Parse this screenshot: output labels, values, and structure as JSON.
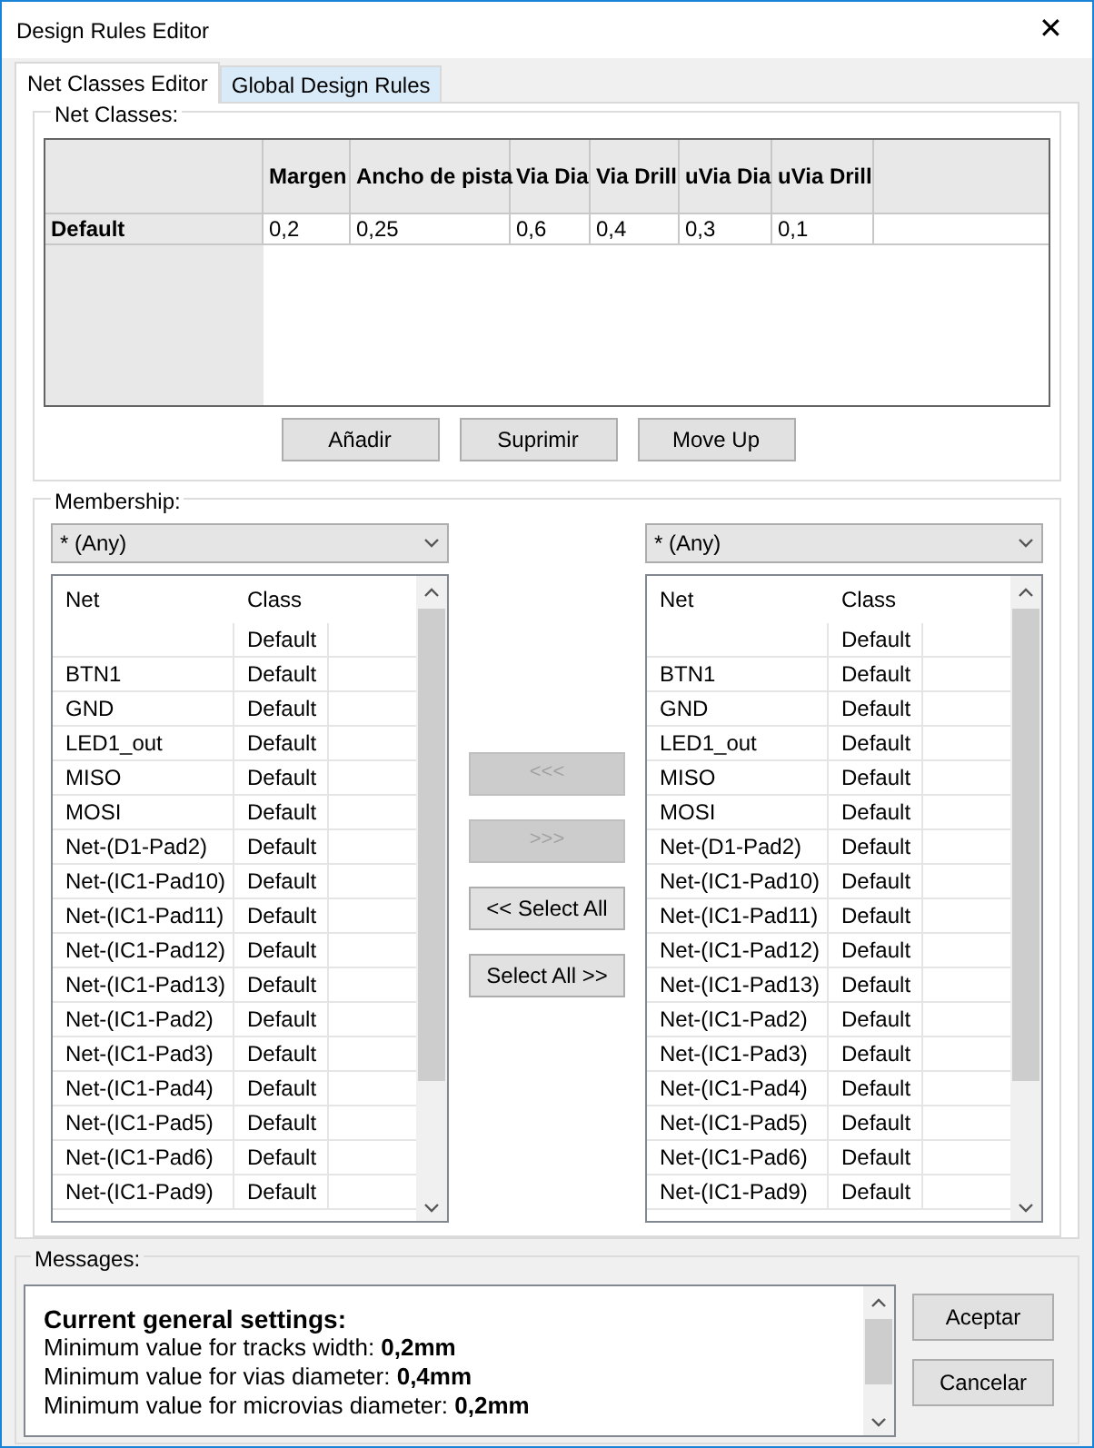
{
  "window": {
    "title": "Design Rules Editor",
    "close": "✕"
  },
  "tabs": [
    {
      "label": "Net Classes Editor",
      "selected": true
    },
    {
      "label": "Global Design Rules",
      "selected": false
    }
  ],
  "net_classes": {
    "label": "Net Classes:",
    "columns": [
      "Margen",
      "Ancho de pista",
      "Via Dia",
      "Via Drill",
      "uVia Dia",
      "uVia Drill"
    ],
    "rows": [
      {
        "name": "Default",
        "values": [
          "0,2",
          "0,25",
          "0,6",
          "0,4",
          "0,3",
          "0,1"
        ]
      }
    ],
    "buttons": [
      "Añadir",
      "Suprimir",
      "Move Up"
    ]
  },
  "membership": {
    "label": "Membership:",
    "left": {
      "filter": "* (Any)",
      "columns": [
        "Net",
        "Class"
      ],
      "rows": [
        {
          "class": "Default"
        },
        {
          "net": "BTN1",
          "class": "Default"
        },
        {
          "net": "GND",
          "class": "Default"
        },
        {
          "net": "LED1_out",
          "class": "Default"
        },
        {
          "net": "MISO",
          "class": "Default"
        },
        {
          "net": "MOSI",
          "class": "Default"
        },
        {
          "net": "Net-(D1-Pad2)",
          "class": "Default"
        },
        {
          "net": "Net-(IC1-Pad10)",
          "class": "Default"
        },
        {
          "net": "Net-(IC1-Pad11)",
          "class": "Default"
        },
        {
          "net": "Net-(IC1-Pad12)",
          "class": "Default"
        },
        {
          "net": "Net-(IC1-Pad13)",
          "class": "Default"
        },
        {
          "net": "Net-(IC1-Pad2)",
          "class": "Default"
        },
        {
          "net": "Net-(IC1-Pad3)",
          "class": "Default"
        },
        {
          "net": "Net-(IC1-Pad4)",
          "class": "Default"
        },
        {
          "net": "Net-(IC1-Pad5)",
          "class": "Default"
        },
        {
          "net": "Net-(IC1-Pad6)",
          "class": "Default"
        },
        {
          "net": "Net-(IC1-Pad9)",
          "class": "Default"
        }
      ]
    },
    "transfer_buttons": [
      {
        "label": "<<<",
        "disabled": true
      },
      {
        "label": ">>>",
        "disabled": true
      },
      {
        "label": "<< Select All",
        "disabled": false
      },
      {
        "label": "Select All >>",
        "disabled": false
      }
    ],
    "right": {
      "filter": "* (Any)",
      "columns": [
        "Net",
        "Class"
      ],
      "rows": [
        {
          "class": "Default"
        },
        {
          "net": "BTN1",
          "class": "Default"
        },
        {
          "net": "GND",
          "class": "Default"
        },
        {
          "net": "LED1_out",
          "class": "Default"
        },
        {
          "net": "MISO",
          "class": "Default"
        },
        {
          "net": "MOSI",
          "class": "Default"
        },
        {
          "net": "Net-(D1-Pad2)",
          "class": "Default"
        },
        {
          "net": "Net-(IC1-Pad10)",
          "class": "Default"
        },
        {
          "net": "Net-(IC1-Pad11)",
          "class": "Default"
        },
        {
          "net": "Net-(IC1-Pad12)",
          "class": "Default"
        },
        {
          "net": "Net-(IC1-Pad13)",
          "class": "Default"
        },
        {
          "net": "Net-(IC1-Pad2)",
          "class": "Default"
        },
        {
          "net": "Net-(IC1-Pad3)",
          "class": "Default"
        },
        {
          "net": "Net-(IC1-Pad4)",
          "class": "Default"
        },
        {
          "net": "Net-(IC1-Pad5)",
          "class": "Default"
        },
        {
          "net": "Net-(IC1-Pad6)",
          "class": "Default"
        },
        {
          "net": "Net-(IC1-Pad9)",
          "class": "Default"
        }
      ]
    }
  },
  "messages": {
    "label": "Messages:",
    "heading": "Current general settings:",
    "lines": [
      "Minimum value for tracks width: **0,2mm**",
      "Minimum value for vias diameter: **0,4mm**",
      "Minimum value for microvias diameter: **0,2mm**"
    ]
  },
  "dialog_buttons": [
    "Aceptar",
    "Cancelar"
  ]
}
